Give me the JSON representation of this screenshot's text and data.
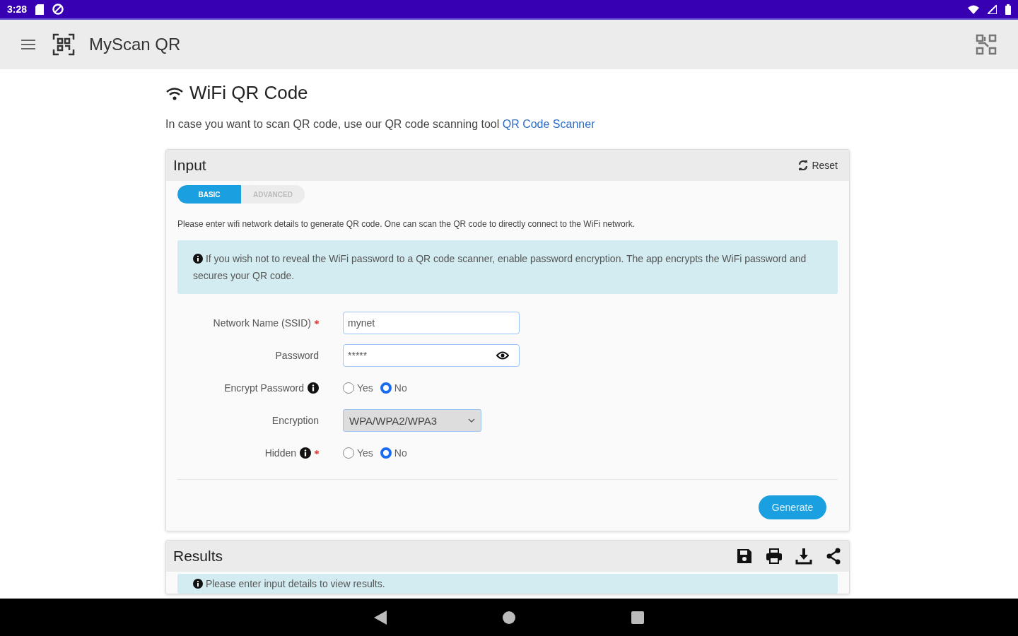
{
  "status_bar": {
    "time": "3:28"
  },
  "app_bar": {
    "title": "MyScan QR"
  },
  "page": {
    "title": "WiFi QR Code",
    "intro": "In case you want to scan QR code, use our QR code scanning tool",
    "intro_link": "QR Code Scanner"
  },
  "input_panel": {
    "title": "Input",
    "reset": "Reset",
    "tabs": [
      {
        "label": "BASIC",
        "selected": true
      },
      {
        "label": "ADVANCED",
        "selected": false
      }
    ],
    "description": "Please enter wifi network details to generate QR code. One can scan the QR code to directly connect to the WiFi network.",
    "info": "If you wish not to reveal the WiFi password to a QR code scanner, enable password encryption. The app encrypts the WiFi password and secures your QR code.",
    "fields": [
      {
        "kind": "text",
        "label": "Network Name (SSID)",
        "required": true,
        "info": false,
        "value": "mynet"
      },
      {
        "kind": "password",
        "label": "Password",
        "required": false,
        "info": false,
        "value": "*****"
      },
      {
        "kind": "radio",
        "label": "Encrypt Password",
        "required": false,
        "info": true,
        "options": [
          {
            "label": "Yes",
            "selected": false
          },
          {
            "label": "No",
            "selected": true
          }
        ]
      },
      {
        "kind": "select",
        "label": "Encryption",
        "required": false,
        "info": false,
        "value": "WPA/WPA2/WPA3"
      },
      {
        "kind": "radio",
        "label": "Hidden",
        "required": true,
        "info": true,
        "options": [
          {
            "label": "Yes",
            "selected": false
          },
          {
            "label": "No",
            "selected": true
          }
        ]
      }
    ],
    "generate": "Generate"
  },
  "results_panel": {
    "title": "Results",
    "message": "Please enter input details to view results."
  }
}
